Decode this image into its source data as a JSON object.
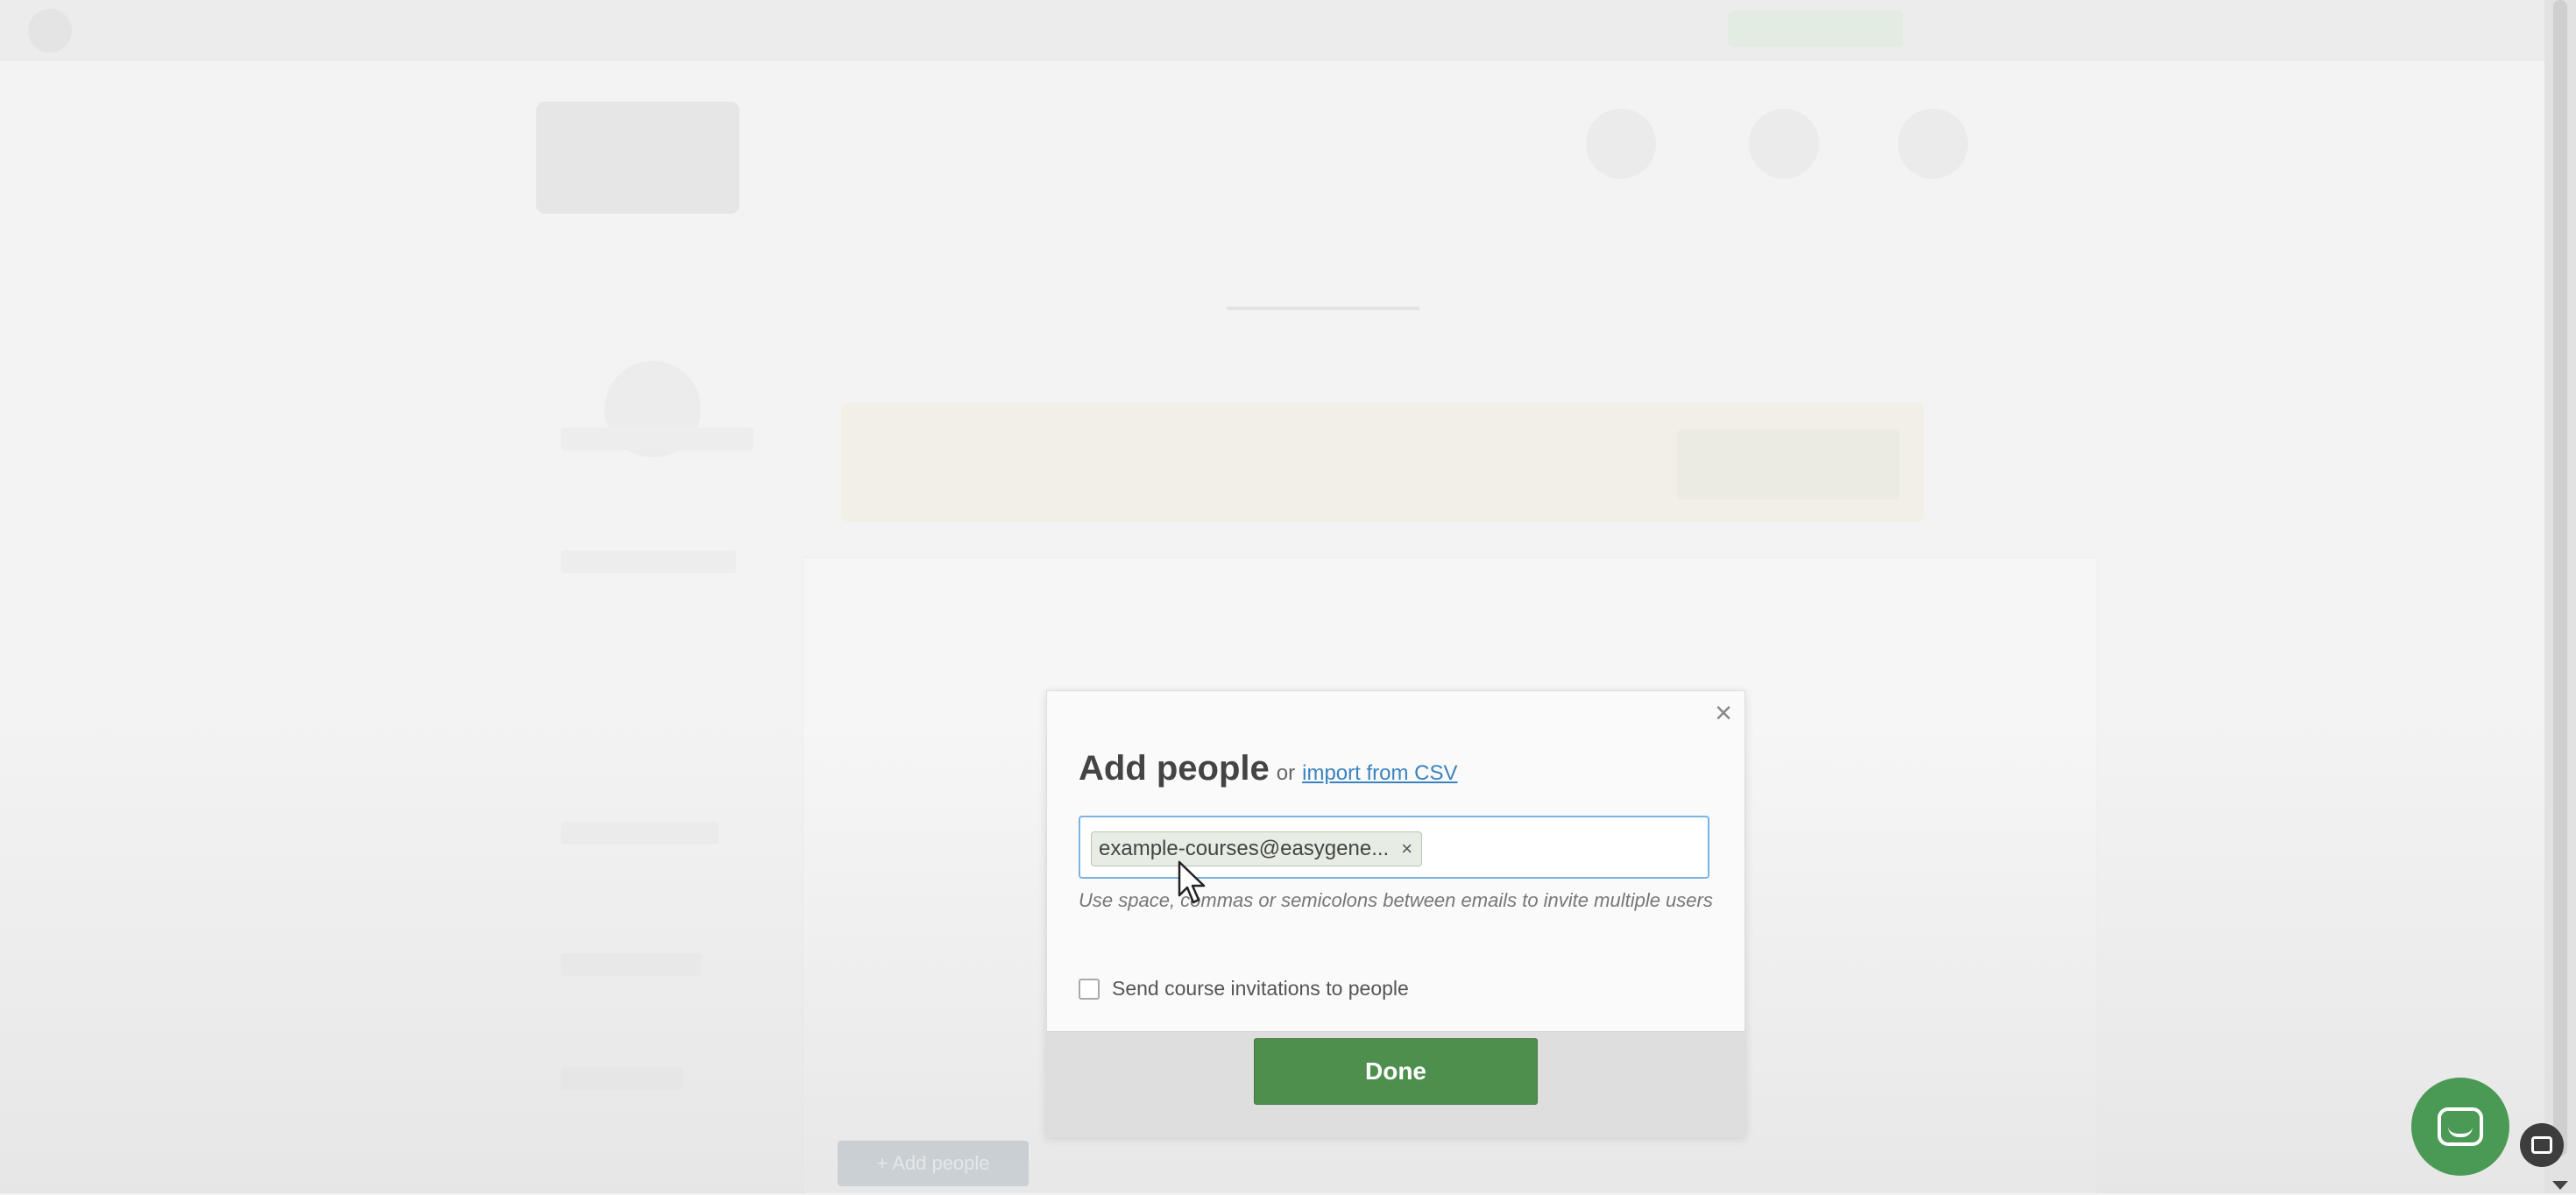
{
  "background": {
    "add_people_label": "+ Add people"
  },
  "modal": {
    "title": "Add people",
    "or_text": "or",
    "import_link": "import from CSV",
    "close_glyph": "×",
    "email_tag": "example-courses@easygene...",
    "email_tag_remove": "×",
    "hint": "Use space, commas or semicolons between emails to invite multiple users",
    "checkbox_label": "Send course invitations to people",
    "checkbox_checked": false,
    "done_label": "Done"
  },
  "icons": {
    "chat": "chat-bubble-icon",
    "screen": "screen-capture-icon",
    "cursor": "mouse-pointer-icon"
  },
  "colors": {
    "done_button": "#4e8f4e",
    "link": "#3b83c0",
    "input_focus_border": "#7ab4e3",
    "chat_bubble": "#4a9a56"
  }
}
